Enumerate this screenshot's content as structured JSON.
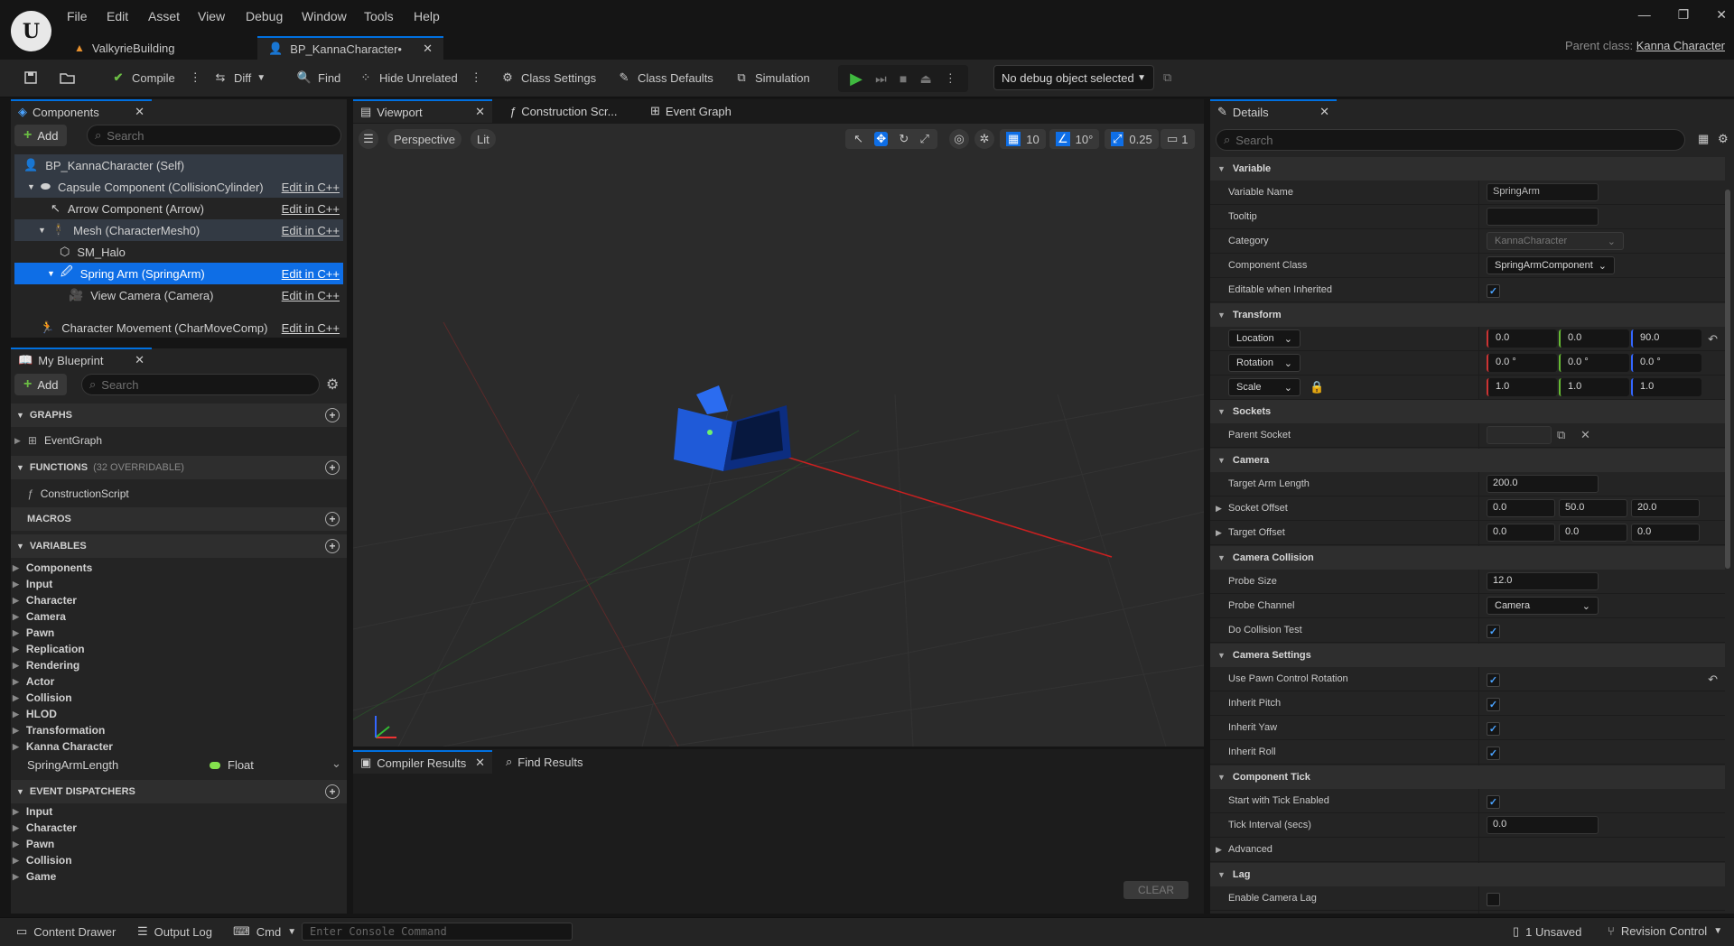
{
  "menu": [
    "File",
    "Edit",
    "Asset",
    "View",
    "Debug",
    "Window",
    "Tools",
    "Help"
  ],
  "doc_tabs": [
    {
      "label": "ValkyrieBuilding"
    },
    {
      "label": "BP_KannaCharacter•"
    }
  ],
  "parent_class": {
    "label": "Parent class:",
    "value": "Kanna Character"
  },
  "toolbar": {
    "compile": "Compile",
    "diff": "Diff",
    "find": "Find",
    "hide_unrelated": "Hide Unrelated",
    "class_settings": "Class Settings",
    "class_defaults": "Class Defaults",
    "simulation": "Simulation",
    "debug_object": "No debug object selected"
  },
  "components_panel": {
    "title": "Components",
    "add": "Add",
    "search_placeholder": "Search",
    "rows": [
      {
        "label": "BP_KannaCharacter (Self)",
        "edit": ""
      },
      {
        "label": "Capsule Component (CollisionCylinder)",
        "edit": "Edit in C++"
      },
      {
        "label": "Arrow Component (Arrow)",
        "edit": "Edit in C++"
      },
      {
        "label": "Mesh (CharacterMesh0)",
        "edit": "Edit in C++"
      },
      {
        "label": "SM_Halo",
        "edit": ""
      },
      {
        "label": "Spring Arm (SpringArm)",
        "edit": "Edit in C++"
      },
      {
        "label": "View Camera (Camera)",
        "edit": "Edit in C++"
      },
      {
        "label": "Character Movement (CharMoveComp)",
        "edit": "Edit in C++"
      }
    ]
  },
  "my_blueprint": {
    "title": "My Blueprint",
    "add": "Add",
    "search_placeholder": "Search",
    "graphs": "GRAPHS",
    "event_graph": "EventGraph",
    "functions": "FUNCTIONS",
    "functions_note": "(32 OVERRIDABLE)",
    "construction": "ConstructionScript",
    "macros": "MACROS",
    "variables": "VARIABLES",
    "var_categories": [
      "Components",
      "Input",
      "Character",
      "Camera",
      "Pawn",
      "Replication",
      "Rendering",
      "Actor",
      "Collision",
      "HLOD",
      "Transformation",
      "Kanna Character"
    ],
    "var_item": {
      "name": "SpringArmLength",
      "type": "Float"
    },
    "event_dispatchers": "EVENT DISPATCHERS",
    "dispatcher_categories": [
      "Input",
      "Character",
      "Pawn",
      "Collision",
      "Game"
    ]
  },
  "center_tabs": [
    "Viewport",
    "Construction Scr...",
    "Event Graph"
  ],
  "viewport": {
    "perspective": "Perspective",
    "lit": "Lit",
    "grid": "10",
    "angle": "10°",
    "scale": "0.25",
    "cam": "1"
  },
  "bottom_tabs": [
    "Compiler Results",
    "Find Results"
  ],
  "clear": "CLEAR",
  "details": {
    "title": "Details",
    "search_placeholder": "Search",
    "variable": {
      "section": "Variable",
      "name_lbl": "Variable Name",
      "name_val": "SpringArm",
      "tooltip_lbl": "Tooltip",
      "tooltip_val": "",
      "category_lbl": "Category",
      "category_val": "KannaCharacter",
      "class_lbl": "Component Class",
      "class_val": "SpringArmComponent",
      "editable_lbl": "Editable when Inherited"
    },
    "transform": {
      "section": "Transform",
      "location": "Location",
      "loc": [
        "0.0",
        "0.0",
        "90.0"
      ],
      "rotation": "Rotation",
      "rot": [
        "0.0 °",
        "0.0 °",
        "0.0 °"
      ],
      "scale": "Scale",
      "scl": [
        "1.0",
        "1.0",
        "1.0"
      ]
    },
    "sockets": {
      "section": "Sockets",
      "parent_lbl": "Parent Socket"
    },
    "camera": {
      "section": "Camera",
      "arm_lbl": "Target Arm Length",
      "arm_val": "200.0",
      "socket_lbl": "Socket Offset",
      "socket": [
        "0.0",
        "50.0",
        "20.0"
      ],
      "target_lbl": "Target Offset",
      "target": [
        "0.0",
        "0.0",
        "0.0"
      ]
    },
    "collision": {
      "section": "Camera Collision",
      "probe_size_lbl": "Probe Size",
      "probe_size_val": "12.0",
      "probe_ch_lbl": "Probe Channel",
      "probe_ch_val": "Camera",
      "do_test_lbl": "Do Collision Test"
    },
    "cam_settings": {
      "section": "Camera Settings",
      "pawn_rot": "Use Pawn Control Rotation",
      "pitch": "Inherit Pitch",
      "yaw": "Inherit Yaw",
      "roll": "Inherit Roll"
    },
    "tick": {
      "section": "Component Tick",
      "start": "Start with Tick Enabled",
      "interval_lbl": "Tick Interval (secs)",
      "interval_val": "0.0"
    },
    "advanced": "Advanced",
    "lag": {
      "section": "Lag",
      "enable": "Enable Camera Lag"
    }
  },
  "statusbar": {
    "content_drawer": "Content Drawer",
    "output_log": "Output Log",
    "cmd": "Cmd",
    "console_placeholder": "Enter Console Command",
    "unsaved": "1 Unsaved",
    "revision": "Revision Control"
  }
}
